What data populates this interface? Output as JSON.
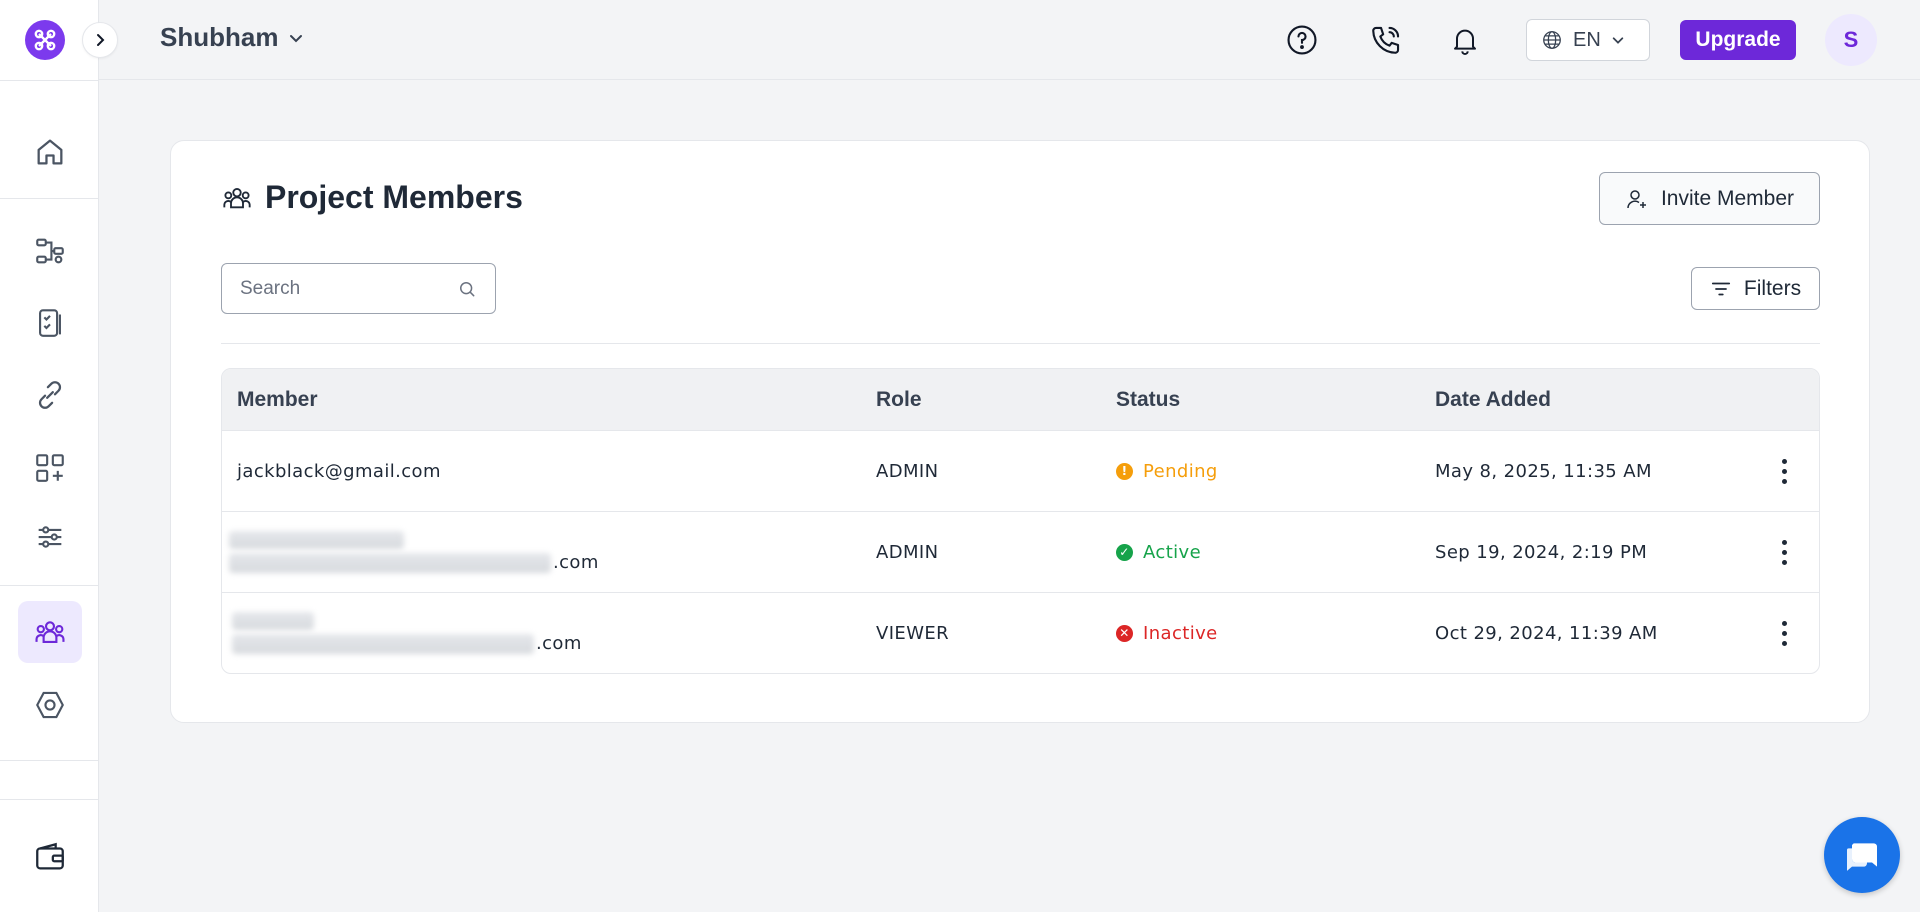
{
  "topbar": {
    "workspace_name": "Shubham",
    "language": "EN",
    "upgrade_label": "Upgrade",
    "avatar_initial": "S"
  },
  "sidebar": {
    "items": [
      {
        "name": "home",
        "icon": "home-icon"
      },
      {
        "name": "workflows",
        "icon": "workflow-icon"
      },
      {
        "name": "forms",
        "icon": "form-checklist-icon"
      },
      {
        "name": "links",
        "icon": "link-icon"
      },
      {
        "name": "apps",
        "icon": "apps-add-icon"
      },
      {
        "name": "settings",
        "icon": "sliders-icon"
      },
      {
        "name": "members",
        "icon": "users-icon",
        "active": true
      },
      {
        "name": "integrations",
        "icon": "hexagon-icon"
      },
      {
        "name": "billing",
        "icon": "wallet-icon"
      }
    ]
  },
  "page": {
    "title": "Project Members",
    "invite_label": "Invite Member",
    "search_placeholder": "Search",
    "filters_label": "Filters"
  },
  "table": {
    "headers": {
      "member": "Member",
      "role": "Role",
      "status": "Status",
      "date": "Date Added"
    },
    "rows": [
      {
        "member": "jackblack@gmail.com",
        "role": "ADMIN",
        "status": "Pending",
        "status_color": "#f59e0b",
        "date": "May 8, 2025, 11:35 AM"
      },
      {
        "member_suffix": ".com",
        "role": "ADMIN",
        "status": "Active",
        "status_color": "#16a34a",
        "date": "Sep 19, 2024, 2:19 PM"
      },
      {
        "member_suffix": ".com",
        "role": "VIEWER",
        "status": "Inactive",
        "status_color": "#dc2626",
        "date": "Oct 29, 2024, 11:39 AM"
      }
    ]
  },
  "colors": {
    "brand": "#6d28d9",
    "pending": "#f59e0b",
    "active": "#16a34a",
    "inactive": "#dc2626",
    "chat": "#1a73e8"
  }
}
